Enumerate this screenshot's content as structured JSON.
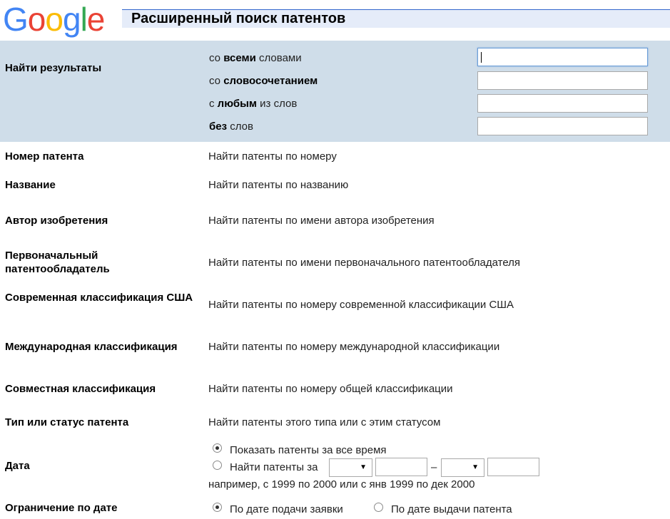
{
  "header": {
    "logo_letters": [
      "G",
      "o",
      "o",
      "g",
      "l",
      "e"
    ],
    "logo_colors": [
      "#4285f4",
      "#ea4335",
      "#fbbc05",
      "#4285f4",
      "#34a853",
      "#ea4335"
    ],
    "title": "Расширенный поиск патентов"
  },
  "find_results": {
    "label": "Найти результаты",
    "options": [
      {
        "pre": "со ",
        "bold": "всеми",
        "post": " словами",
        "value": ""
      },
      {
        "pre": "со ",
        "bold": "словосочетанием",
        "post": "",
        "value": ""
      },
      {
        "pre": "с ",
        "bold": "любым",
        "post": " из слов",
        "value": ""
      },
      {
        "pre": "",
        "bold": "без",
        "post": " слов",
        "value": ""
      }
    ]
  },
  "fields": [
    {
      "label": "Номер патента",
      "desc": "Найти патенты по номеру"
    },
    {
      "label": "Название",
      "desc": "Найти патенты по названию"
    },
    {
      "label": "Автор изобретения",
      "desc": "Найти патенты по имени автора изобретения"
    },
    {
      "label": "Первоначальный патентообладатель",
      "desc": "Найти патенты по имени первоначального патентообладателя"
    },
    {
      "label": "Современная классификация США",
      "desc": "Найти патенты по номеру современной классификации США"
    },
    {
      "label": "Международная классификация",
      "desc": "Найти патенты по номеру международной классификации"
    },
    {
      "label": "Совместная классификация",
      "desc": "Найти патенты по номеру общей классификации"
    },
    {
      "label": "Тип или статус патента",
      "desc": "Найти патенты этого типа или с этим статусом"
    }
  ],
  "date": {
    "label": "Дата",
    "all_time": "Показать патенты за все время",
    "find_for": "Найти патенты за",
    "dash": "–",
    "example": "например, с 1999 по 2000 или с янв 1999 по дек 2000",
    "from_month": "",
    "from_year": "",
    "to_month": "",
    "to_year": ""
  },
  "date_limit": {
    "label": "Ограничение по дате",
    "by_filing": "По дате подачи заявки",
    "by_issue": "По дате выдачи патента"
  }
}
